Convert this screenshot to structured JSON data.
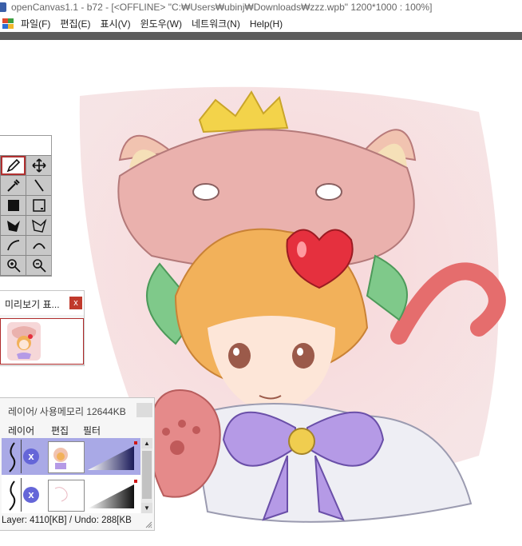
{
  "window": {
    "title": "openCanvas1.1  -  b72  -  [<OFFLINE>  \"C:₩Users₩ubinj₩Downloads₩zzz.wpb\"  1200*1000 : 100%]"
  },
  "menubar": {
    "items": [
      {
        "label": "파일(F)"
      },
      {
        "label": "편집(E)"
      },
      {
        "label": "표시(V)"
      },
      {
        "label": "윈도우(W)"
      },
      {
        "label": "네트워크(N)"
      },
      {
        "label": "Help(H)"
      }
    ]
  },
  "tools": [
    {
      "icon": "pen-icon",
      "active": true
    },
    {
      "icon": "move-icon"
    },
    {
      "icon": "eyedropper-icon"
    },
    {
      "icon": "line-icon"
    },
    {
      "icon": "fill-rect-icon"
    },
    {
      "icon": "rect-select-icon"
    },
    {
      "icon": "fill-poly-icon"
    },
    {
      "icon": "poly-select-icon"
    },
    {
      "icon": "curve-icon"
    },
    {
      "icon": "arc-icon"
    },
    {
      "icon": "zoom-in-icon"
    },
    {
      "icon": "zoom-out-icon"
    }
  ],
  "preview_panel": {
    "title": "미리보기 표...",
    "close_label": "x"
  },
  "layer_panel": {
    "title": "레이어/ 사용메모리 12644KB",
    "tabs": [
      "레이어",
      "편집",
      "필터"
    ],
    "layers": [
      {
        "selected": true,
        "hidden_mark": "x"
      },
      {
        "selected": false,
        "hidden_mark": "x"
      }
    ],
    "status": "Layer: 4110[KB] / Undo: 288[KB"
  },
  "colors": {
    "accent_red": "#c0392b",
    "layer_selected": "#a9a9e6",
    "toolbar_dark": "#5c5c5c"
  }
}
